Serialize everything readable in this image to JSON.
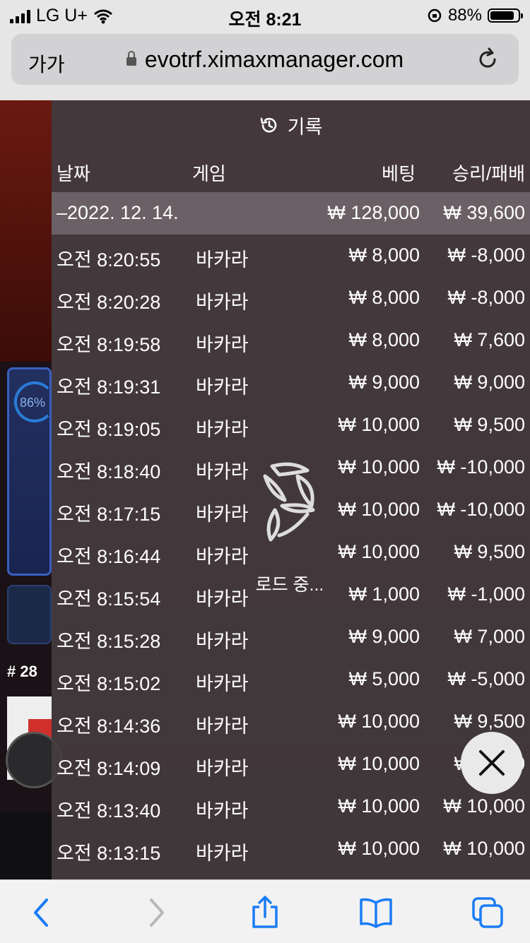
{
  "status_bar": {
    "carrier": "LG U+",
    "time": "오전 8:21",
    "battery": "88%",
    "battery_level": 0.88
  },
  "browser": {
    "text_size_label": "가가",
    "url": "evotrf.ximaxmanager.com"
  },
  "background": {
    "progress_label": "86%",
    "table_number": "# 28"
  },
  "panel": {
    "title": "기록",
    "columns": {
      "date": "날짜",
      "game": "게임",
      "bet": "베팅",
      "result": "승리/패배"
    },
    "summary": {
      "date": "–2022. 12. 14.",
      "bet": "₩ 128,000",
      "result": "₩ 39,600"
    },
    "rows": [
      {
        "time": "오전 8:20:55",
        "game": "바카라",
        "bet": "₩ 8,000",
        "result": "₩ -8,000"
      },
      {
        "time": "오전 8:20:28",
        "game": "바카라",
        "bet": "₩ 8,000",
        "result": "₩ -8,000"
      },
      {
        "time": "오전 8:19:58",
        "game": "바카라",
        "bet": "₩ 8,000",
        "result": "₩ 7,600"
      },
      {
        "time": "오전 8:19:31",
        "game": "바카라",
        "bet": "₩ 9,000",
        "result": "₩ 9,000"
      },
      {
        "time": "오전 8:19:05",
        "game": "바카라",
        "bet": "₩ 10,000",
        "result": "₩ 9,500"
      },
      {
        "time": "오전 8:18:40",
        "game": "바카라",
        "bet": "₩ 10,000",
        "result": "₩ -10,000"
      },
      {
        "time": "오전 8:17:15",
        "game": "바카라",
        "bet": "₩ 10,000",
        "result": "₩ -10,000"
      },
      {
        "time": "오전 8:16:44",
        "game": "바카라",
        "bet": "₩ 10,000",
        "result": "₩ 9,500"
      },
      {
        "time": "오전 8:15:54",
        "game": "바카라",
        "bet": "₩ 1,000",
        "result": "₩ -1,000"
      },
      {
        "time": "오전 8:15:28",
        "game": "바카라",
        "bet": "₩ 9,000",
        "result": "₩ 7,000"
      },
      {
        "time": "오전 8:15:02",
        "game": "바카라",
        "bet": "₩ 5,000",
        "result": "₩ -5,000"
      },
      {
        "time": "오전 8:14:36",
        "game": "바카라",
        "bet": "₩ 10,000",
        "result": "₩ 9,500"
      },
      {
        "time": "오전 8:14:09",
        "game": "바카라",
        "bet": "₩ 10,000",
        "result": "₩ 9,000"
      },
      {
        "time": "오전 8:13:40",
        "game": "바카라",
        "bet": "₩ 10,000",
        "result": "₩ 10,000"
      },
      {
        "time": "오전 8:13:15",
        "game": "바카라",
        "bet": "₩ 10,000",
        "result": "₩ 10,000"
      }
    ],
    "loading_text": "로드 중..."
  },
  "colors": {
    "panel_bg": "#463c40",
    "summary_bg": "#786e73",
    "ios_blue": "#1a7cf5",
    "chip_gold": "#e8c840"
  },
  "icons": [
    "history-icon",
    "close-icon",
    "lock-icon",
    "reload-icon",
    "back-icon",
    "forward-icon",
    "share-icon",
    "bookmarks-icon",
    "tabs-icon",
    "wifi-icon",
    "battery-icon",
    "loading-spinner-icon"
  ]
}
